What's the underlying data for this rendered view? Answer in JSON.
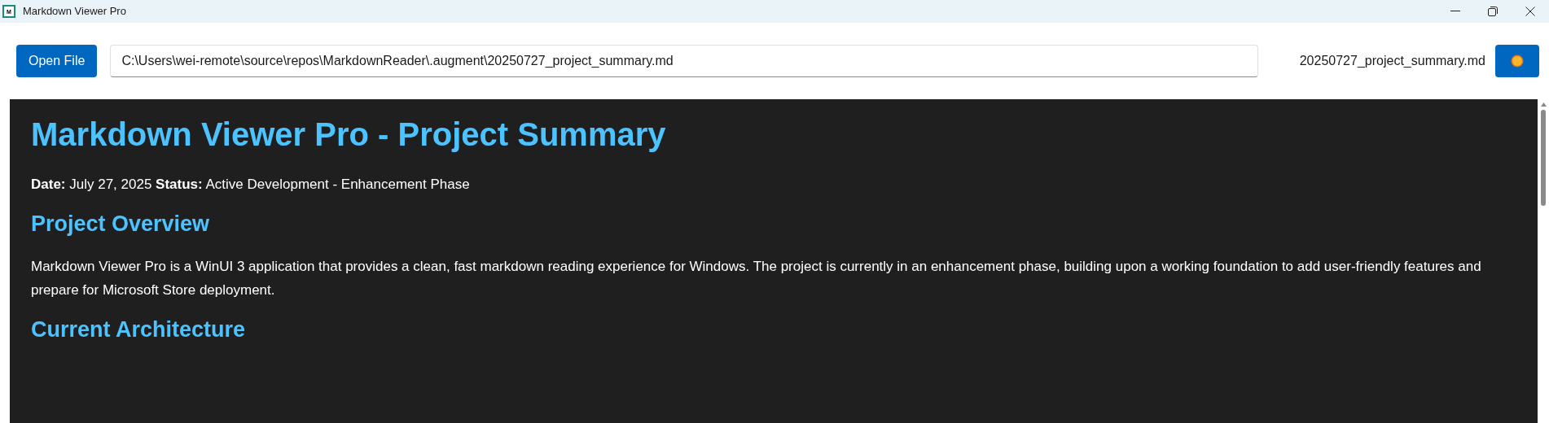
{
  "window": {
    "title": "Markdown Viewer Pro",
    "app_icon_letter": "M"
  },
  "toolbar": {
    "open_button": "Open File",
    "path_value": "C:\\Users\\wei-remote\\source\\repos\\MarkdownReader\\.augment\\20250727_project_summary.md",
    "file_name": "20250727_project_summary.md"
  },
  "document": [
    {
      "kind": "h1",
      "text": "Markdown Viewer Pro - Project Summary"
    },
    {
      "kind": "p",
      "text": "**Date:** July 27, 2025 **Status:** Active Development - Enhancement Phase"
    },
    {
      "kind": "h2",
      "text": "Project Overview"
    },
    {
      "kind": "p",
      "text": "Markdown Viewer Pro is a WinUI 3 application that provides a clean, fast markdown reading experience for Windows. The project is currently in an enhancement phase, building upon a working foundation to add user-friendly features and prepare for Microsoft Store deployment."
    },
    {
      "kind": "h2",
      "text": "Current Architecture"
    }
  ]
}
